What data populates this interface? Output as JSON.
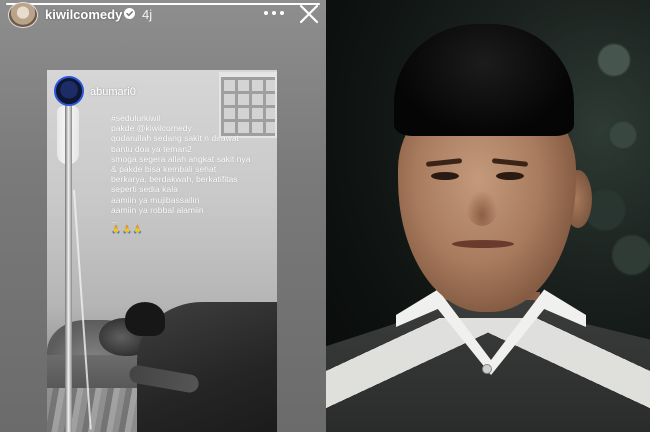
{
  "story": {
    "username": "kiwilcomedy",
    "time_ago": "4j",
    "progress_fraction": 1.0,
    "icons": {
      "verified": "verified-badge-icon",
      "more": "more-options-icon",
      "close": "close-icon"
    },
    "reposted": {
      "username": "abumari0",
      "caption_lines": [
        "#sedulurkiwil",
        "pakde @kiwilcomedy",
        "qodarullah sedang sakit n dirawat",
        "bantu doa ya teman2",
        "smoga segera allah angkat sakit nya",
        "& pakde bisa kembali sehat",
        "berkarya, berdakwah, berkatifitas",
        "seperti sedia kala",
        "aamiin ya mujibassailin",
        "aamiin ya robbal alamiin",
        "...",
        "🙏🙏🙏"
      ]
    }
  },
  "colors": {
    "story_background": "#7a7a7a",
    "text": "#ffffff",
    "portrait_background": "#0d110f"
  }
}
